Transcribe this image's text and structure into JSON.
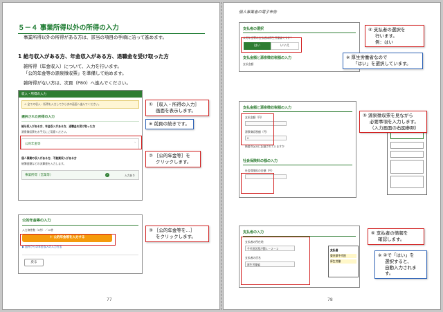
{
  "left_page": {
    "header": "",
    "title": "５－４ 事業所得以外の所得の入力",
    "intro": "事業所得以外の所得がある方は、該当の項目の手順に沿って進めます。",
    "subheading": "1 給与収入がある方、年金収入がある方、退職金を受け取った方",
    "para1_line1": "雑所得（年金収入）について、入力を行います。",
    "para1_line2": "「公的年金等の源泉徴収票」を準備して始めます。",
    "para2": "雑所得がない方は、次頁（P80）へ進んでください。",
    "page_number": "77",
    "screen1": {
      "bar": "収入・所得の入力",
      "warning": "全ての収入・所得を入力してから次の画面へ進んでください。",
      "selected_heading": "選択された所得の入力",
      "group_label": "給与収入がある方、年金収入がある方、退職金を受け取った方",
      "group_desc": "源泉徴収票をお手元にご用意ください。",
      "pension_row": "公的年金等",
      "group2_label": "個人事業の収入がある方、不動業収入がある方",
      "group2_desc": "帳簿書類などの決算書を入力します。",
      "business_row": "事業所得（営業等）",
      "business_status": "入力あり"
    },
    "screen2": {
      "heading": "公的年金等の入力",
      "count_text": "入力済件数（0件）／10件",
      "add_button": "＋ 公的年金等を入力する",
      "link_text": "▶ 国外からの年金収入の入力方法",
      "back_button": "戻る"
    },
    "callouts": {
      "c1_line1": "① ［収入・所得の入力］",
      "c1_line2": "画面を表示します。",
      "note1": "※ 前頁の続きです。",
      "c2_line1": "② ［公的年金等］を",
      "c2_line2": "クリックします。",
      "c3_line1": "③ ［公的年金等を…］",
      "c3_line2": "をクリックします。"
    }
  },
  "right_page": {
    "header": "個人事業者の電子申告",
    "page_number": "78",
    "screenA": {
      "title": "支払者の選択",
      "question": "公的年金等の支払者は厚生労働省ですか？",
      "yes": "はい",
      "no": "いいえ",
      "section": "支払金額と源泉徴収税額の入力",
      "row_label": "支払金額"
    },
    "screenB": {
      "title": "支払金額と源泉徴収税額の入力",
      "amount_label": "支払金額（円）",
      "tax_label": "源泉徴収税額（円）",
      "tax_value": "0",
      "question": "摘要の区分に記載されていますか",
      "social_title": "社会保険料の額の入力",
      "social_label": "社会保険料の金額（円）"
    },
    "screenC": {
      "title": "支払者の入力",
      "address_label": "支払者の所在地",
      "address_value": "千代田区霞が関１－２－２",
      "name_label": "支払者の氏名",
      "name_value": "厚生労働省",
      "doc_line1": "支払者",
      "doc_line2": "東京都千代田",
      "doc_line3": "厚生労働"
    },
    "callouts": {
      "c4_line1": "④ 支払者の選択を",
      "c4_line2": "行います。",
      "c4_line3": "例：はい",
      "note2_line1": "※ 厚生労働省なので",
      "note2_line2": "「はい」を選択しています。",
      "c5_line1": "⑤ 源泉徴収票を見ながら",
      "c5_line2": "必要事項を入力します。",
      "c5_line3": "（入力画面の右図参照）",
      "c6_line1": "⑥ 支払者の情報を",
      "c6_line2": "確認します。",
      "note3_line1": "※ ④で「はい」を",
      "note3_line2": "選択すると、",
      "note3_line3": "自動入力されます。"
    }
  },
  "colors": {
    "green": "#2e7d32",
    "red": "#d21f1f",
    "blue": "#2f64b8",
    "orange": "#f59a0b"
  }
}
